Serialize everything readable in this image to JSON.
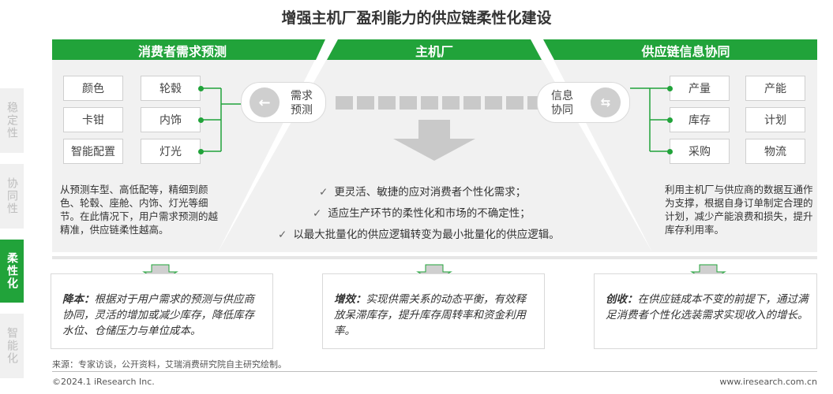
{
  "title": "增强主机厂盈利能力的供应链柔性化建设",
  "side_tabs": [
    {
      "label": "稳定性",
      "active": false
    },
    {
      "label": "协同性",
      "active": false
    },
    {
      "label": "柔性化",
      "active": true
    },
    {
      "label": "智能化",
      "active": false
    }
  ],
  "headers": {
    "left": "消费者需求预测",
    "center": "主机厂",
    "right": "供应链信息协同"
  },
  "left_chips_col1": [
    "颜色",
    "卡钳",
    "智能配置"
  ],
  "left_chips_col2": [
    "轮毂",
    "内饰",
    "灯光"
  ],
  "right_chips_col1": [
    "产量",
    "库存",
    "采购"
  ],
  "right_chips_col2": [
    "产能",
    "计划",
    "物流"
  ],
  "demand_forecast": {
    "icon": "arrow-left-icon",
    "label_line1": "需求",
    "label_line2": "预测"
  },
  "info_sync": {
    "icon": "exchange-arrows-icon",
    "label_line1": "信息",
    "label_line2": "协同"
  },
  "left_desc": "从预测车型、高低配等，精细到颜色、轮毂、座舱、内饰、灯光等细节。在此情况下，用户需求预测的越精准，供应链柔性越高。",
  "right_desc": "利用主机厂与供应商的数据互通作为支撑，根据自身订单制定合理的计划，减少产能浪费和损失，提升库存利用率。",
  "center_points": [
    "更灵活、敏捷的应对消费者个性化需求；",
    "适应生产环节的柔性化和市场的不确定性；",
    "以最大批量化的供应逻辑转变为最小批量化的供应逻辑。"
  ],
  "bottom": [
    {
      "label": "降本：",
      "text": "根据对于用户需求的预测与供应商协同，灵活的增加或减少库存，降低库存水位、仓储压力与单位成本。"
    },
    {
      "label": "增效：",
      "text": "实现供需关系的动态平衡，有效释放呆滞库存，提升库存周转率和资金利用率。"
    },
    {
      "label": "创收：",
      "text": "在供应链成本不变的前提下，通过满足消费者个性化选装需求实现收入的增长。"
    }
  ],
  "source": "来源：专家访谈，公开资料，艾瑞消费研究院自主研究绘制。",
  "footer_left": "©2024.1 iResearch Inc.",
  "footer_right": "www.iresearch.com.cn",
  "colors": {
    "green": "#21a33a",
    "panel": "#f1f1f1",
    "gray_arrow": "#c9c9c9"
  }
}
